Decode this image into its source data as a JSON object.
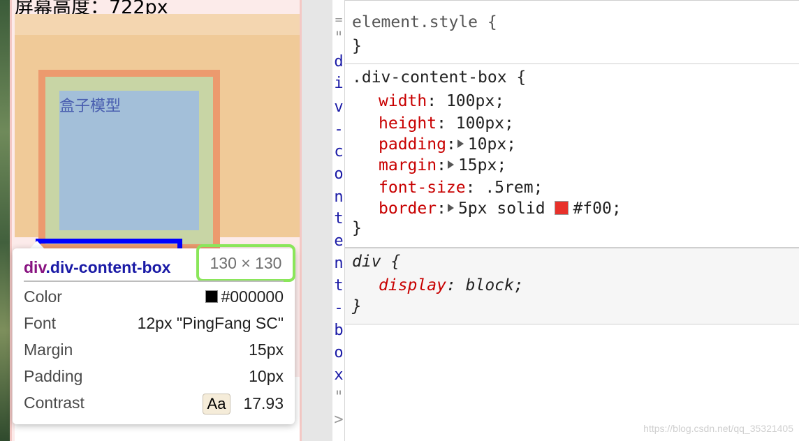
{
  "page": {
    "screen_height_text": "屏幕高度：722px",
    "box_label": "盒子模型"
  },
  "tooltip": {
    "selector_tag": "div",
    "selector_class": ".div-content-box",
    "size": "130 × 130",
    "rows": [
      {
        "key": "Color",
        "value": "#000000"
      },
      {
        "key": "Font",
        "value": "12px \"PingFang SC\""
      },
      {
        "key": "Margin",
        "value": "15px"
      },
      {
        "key": "Padding",
        "value": "10px"
      },
      {
        "key": "Contrast",
        "chip": "Aa",
        "value": "17.93"
      }
    ]
  },
  "dom_gutter": {
    "chars": [
      "\"",
      "d",
      "i",
      "v",
      "-",
      "c",
      "o",
      "n",
      "t",
      "e",
      "n",
      "t",
      "-",
      "b",
      "o",
      "x",
      "\"",
      ">"
    ]
  },
  "styles": {
    "element_style": {
      "selector": "element.style {",
      "close": "}"
    },
    "main_rule": {
      "selector": ".div-content-box {",
      "declarations": [
        {
          "prop": "width",
          "value": "100px;"
        },
        {
          "prop": "height",
          "value": "100px;"
        },
        {
          "prop": "padding",
          "value": "10px;",
          "expandable": true
        },
        {
          "prop": "margin",
          "value": "15px;",
          "expandable": true
        },
        {
          "prop": "font-size",
          "value": ".5rem;"
        },
        {
          "prop": "border",
          "value_pre": "5px solid ",
          "value_color": "#f00;",
          "expandable": true,
          "swatch": "#e8312a"
        }
      ],
      "close": "}"
    },
    "div_rule": {
      "selector": "div {",
      "declarations": [
        {
          "prop": "display",
          "value": "block;"
        }
      ],
      "close": "}"
    }
  },
  "watermark": "https://blog.csdn.net/qq_35321405"
}
